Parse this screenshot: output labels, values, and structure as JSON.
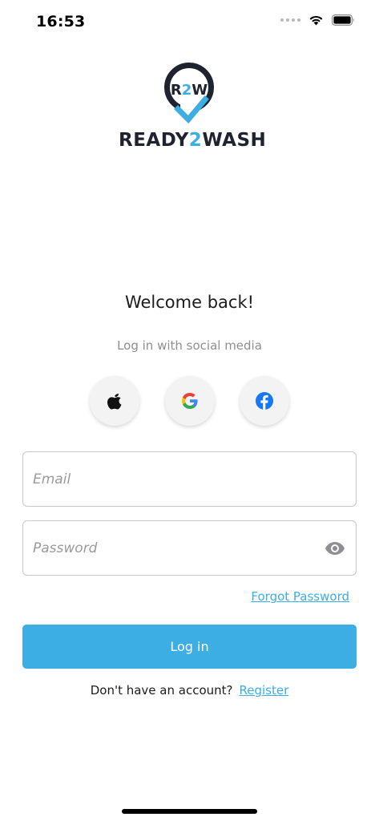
{
  "status_bar": {
    "time": "16:53"
  },
  "brand": {
    "mark_text": "R2W",
    "name_part1": "READY",
    "name_accent": "2",
    "name_part2": "WASH",
    "colors": {
      "dark": "#1f2330",
      "accent": "#3caee3"
    }
  },
  "login": {
    "welcome": "Welcome back!",
    "social_caption": "Log in with social media",
    "social_buttons": [
      {
        "icon": "apple-icon"
      },
      {
        "icon": "google-icon"
      },
      {
        "icon": "facebook-icon"
      }
    ],
    "email": {
      "placeholder": "Email",
      "value": ""
    },
    "password": {
      "placeholder": "Password",
      "value": "",
      "toggle_icon": "eye-icon"
    },
    "forgot_password": "Forgot Password",
    "login_button": "Log in",
    "register_prompt": "Don't have an account?",
    "register_link": "Register"
  },
  "colors": {
    "primary": "#3caee3",
    "text": "#1c1c1e",
    "muted": "#8e8e93",
    "field_border": "#c7c7cc"
  }
}
